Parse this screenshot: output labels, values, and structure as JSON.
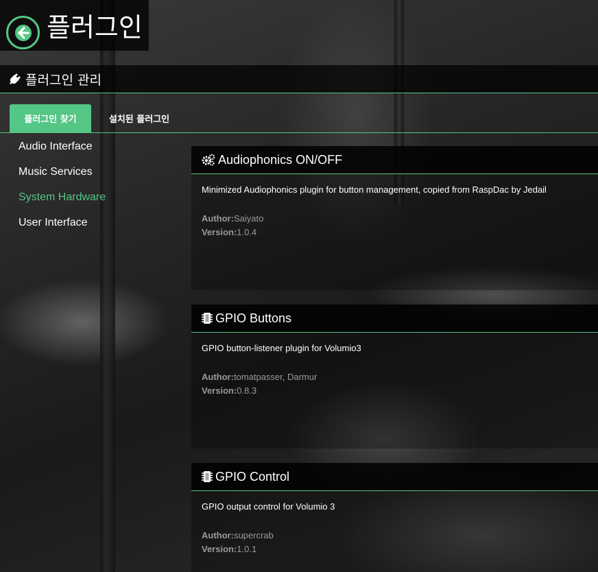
{
  "header": {
    "title": "플러그인"
  },
  "section": {
    "title": "플러그인 관리"
  },
  "tabs": [
    {
      "label": "플러그인 찾기",
      "active": true
    },
    {
      "label": "설치된 플러그인",
      "active": false
    }
  ],
  "sidebar": {
    "items": [
      {
        "label": "Audio Interface",
        "active": false
      },
      {
        "label": "Music Services",
        "active": false
      },
      {
        "label": "System Hardware",
        "active": true
      },
      {
        "label": "User Interface",
        "active": false
      }
    ]
  },
  "plugins": [
    {
      "icon": "gears-icon",
      "name": "Audiophonics ON/OFF",
      "description": "Minimized Audiophonics plugin for button management, copied from RaspDac by Jedail",
      "author_label": "Author:",
      "author": "Saiyato",
      "version_label": "Version:",
      "version": "1.0.4"
    },
    {
      "icon": "chip-icon",
      "name": "GPIO Buttons",
      "description": "GPIO button-listener plugin for Volumio3",
      "author_label": "Author:",
      "author": "tomatpasser, Darmur",
      "version_label": "Version:",
      "version": "0.8.3"
    },
    {
      "icon": "chip-icon",
      "name": "GPIO Control",
      "description": "GPIO output control for Volumio 3",
      "author_label": "Author:",
      "author": "supercrab",
      "version_label": "Version:",
      "version": "1.0.1"
    }
  ],
  "colors": {
    "accent": "#54c685",
    "meta_text": "#9a9a9a"
  }
}
